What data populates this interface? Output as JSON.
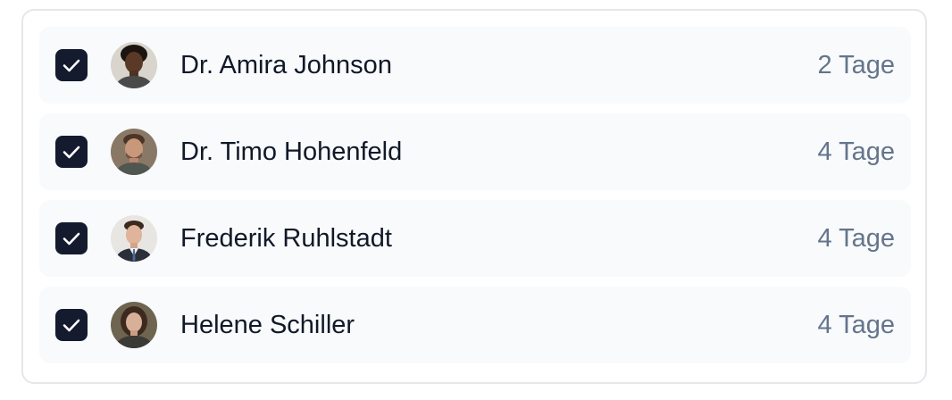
{
  "people": [
    {
      "name": "Dr. Amira Johnson",
      "duration": "2 Tage",
      "checked": true
    },
    {
      "name": "Dr. Timo Hohenfeld",
      "duration": "4 Tage",
      "checked": true
    },
    {
      "name": "Frederik Ruhlstadt",
      "duration": "4 Tage",
      "checked": true
    },
    {
      "name": "Helene Schiller",
      "duration": "4 Tage",
      "checked": true
    }
  ],
  "colors": {
    "checkbox_fill": "#151b2e",
    "name_text": "#111827",
    "duration_text": "#64748b",
    "row_background": "#f8fafc"
  }
}
